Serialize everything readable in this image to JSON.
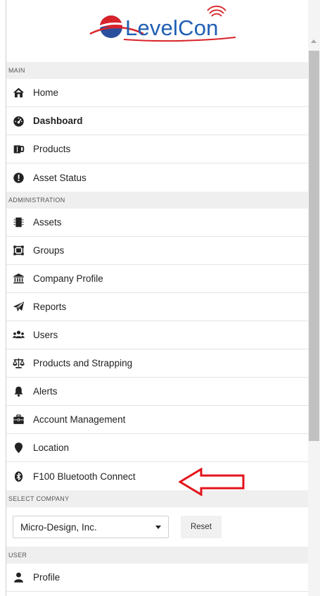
{
  "brand": {
    "name": "LevelCon"
  },
  "sections": {
    "main": {
      "label": "MAIN",
      "items": [
        {
          "label": "Home",
          "icon": "home-icon"
        },
        {
          "label": "Dashboard",
          "icon": "dashboard-icon"
        },
        {
          "label": "Products",
          "icon": "products-icon"
        },
        {
          "label": "Asset Status",
          "icon": "alert-circle-icon"
        }
      ]
    },
    "administration": {
      "label": "ADMINISTRATION",
      "items": [
        {
          "label": "Assets",
          "icon": "assets-icon"
        },
        {
          "label": "Groups",
          "icon": "groups-icon"
        },
        {
          "label": "Company Profile",
          "icon": "bank-icon"
        },
        {
          "label": "Reports",
          "icon": "paper-plane-icon"
        },
        {
          "label": "Users",
          "icon": "users-icon"
        },
        {
          "label": "Products and Strapping",
          "icon": "balance-scale-icon"
        },
        {
          "label": "Alerts",
          "icon": "bell-icon"
        },
        {
          "label": "Account Management",
          "icon": "briefcase-icon"
        },
        {
          "label": "Location",
          "icon": "map-marker-icon"
        },
        {
          "label": "F100 Bluetooth Connect",
          "icon": "bluetooth-icon"
        }
      ]
    },
    "select_company": {
      "label": "SELECT COMPANY",
      "selected": "Micro-Design, Inc.",
      "reset_label": "Reset"
    },
    "user": {
      "label": "USER",
      "items": [
        {
          "label": "Profile",
          "icon": "user-icon"
        }
      ]
    }
  },
  "colors": {
    "brand_blue": "#1f5fb4",
    "brand_red": "#d8232a",
    "annotation_arrow": "#e3131b"
  }
}
